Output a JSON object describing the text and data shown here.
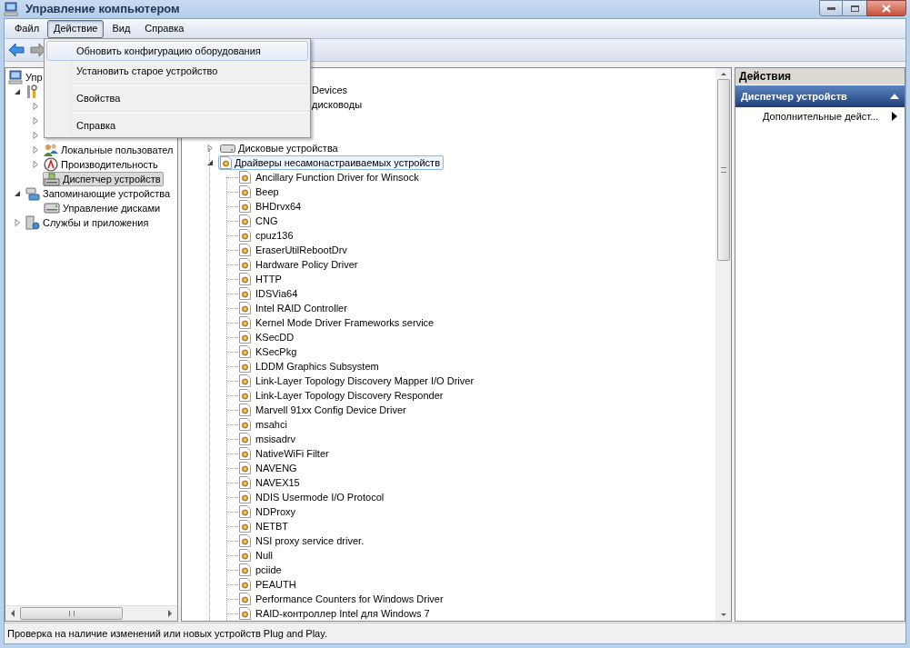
{
  "window": {
    "title": "Управление компьютером"
  },
  "menu_bar": [
    {
      "label": "Файл",
      "selected": false
    },
    {
      "label": "Действие",
      "selected": true
    },
    {
      "label": "Вид",
      "selected": false
    },
    {
      "label": "Справка",
      "selected": false
    }
  ],
  "open_menu": {
    "items": [
      {
        "kind": "item",
        "label": "Обновить конфигурацию оборудования",
        "selected": true
      },
      {
        "kind": "item",
        "label": "Установить старое устройство",
        "selected": false
      },
      {
        "kind": "separator"
      },
      {
        "kind": "item",
        "label": "Свойства",
        "selected": false
      },
      {
        "kind": "separator"
      },
      {
        "kind": "item",
        "label": "Справка",
        "selected": false
      }
    ]
  },
  "navigation_tree": [
    {
      "label": "Упр",
      "selected": false,
      "children": [
        {
          "expanded": true,
          "children": [
            {
              "expanded": false
            },
            {
              "expanded": false
            },
            {
              "expanded": false
            },
            {
              "label": "Локальные пользовател",
              "expanded": false,
              "selected": false
            },
            {
              "label": "Производительность",
              "expanded": false,
              "selected": false
            },
            {
              "label": "Диспетчер устройств",
              "selected": true
            }
          ]
        },
        {
          "label": "Запоминающие устройства",
          "expanded": true,
          "selected": false,
          "children": [
            {
              "label": "Управление дисками",
              "selected": false
            }
          ]
        },
        {
          "label": "Службы и приложения",
          "expanded": false,
          "selected": false
        }
      ]
    }
  ],
  "device_tree": [
    {
      "kind": "covered"
    },
    {
      "kind": "covered",
      "label": "Devices"
    },
    {
      "kind": "covered",
      "label": "дисководы"
    },
    {
      "kind": "covered"
    },
    {
      "kind": "covered"
    },
    {
      "kind": "node",
      "label": "Дисковые устройства",
      "expanded": false,
      "selected": false
    },
    {
      "kind": "node",
      "label": "Драйверы несамонастраиваемых устройств",
      "expanded": true,
      "selected": true,
      "children": [
        {
          "label": "Ancillary Function Driver for Winsock",
          "selected": false
        },
        {
          "label": "Beep",
          "selected": false
        },
        {
          "label": "BHDrvx64",
          "selected": false
        },
        {
          "label": "CNG",
          "selected": false
        },
        {
          "label": "cpuz136",
          "selected": false
        },
        {
          "label": "EraserUtilRebootDrv",
          "selected": false
        },
        {
          "label": "Hardware Policy Driver",
          "selected": false
        },
        {
          "label": "HTTP",
          "selected": false
        },
        {
          "label": "IDSVia64",
          "selected": false
        },
        {
          "label": "Intel RAID Controller",
          "selected": false
        },
        {
          "label": "Kernel Mode Driver Frameworks service",
          "selected": false
        },
        {
          "label": "KSecDD",
          "selected": false
        },
        {
          "label": "KSecPkg",
          "selected": false
        },
        {
          "label": "LDDM Graphics Subsystem",
          "selected": false
        },
        {
          "label": "Link-Layer Topology Discovery Mapper I/O Driver",
          "selected": false
        },
        {
          "label": "Link-Layer Topology Discovery Responder",
          "selected": false
        },
        {
          "label": "Marvell 91xx Config Device Driver",
          "selected": false
        },
        {
          "label": "msahci",
          "selected": false
        },
        {
          "label": "msisadrv",
          "selected": false
        },
        {
          "label": "NativeWiFi Filter",
          "selected": false
        },
        {
          "label": "NAVENG",
          "selected": false
        },
        {
          "label": "NAVEX15",
          "selected": false
        },
        {
          "label": "NDIS Usermode I/O Protocol",
          "selected": false
        },
        {
          "label": "NDProxy",
          "selected": false
        },
        {
          "label": "NETBT",
          "selected": false
        },
        {
          "label": "NSI proxy service driver.",
          "selected": false
        },
        {
          "label": "Null",
          "selected": false
        },
        {
          "label": "pciide",
          "selected": false
        },
        {
          "label": "PEAUTH",
          "selected": false
        },
        {
          "label": "Performance Counters for Windows Driver",
          "selected": false
        },
        {
          "label": "RAID-контроллер Intel для Windows 7",
          "selected": false
        }
      ]
    }
  ],
  "actions_pane": {
    "title": "Действия",
    "section": {
      "title": "Диспетчер устройств",
      "expanded": true
    },
    "items": [
      {
        "label": "Дополнительные дейст...",
        "has_submenu": true
      }
    ]
  },
  "status_bar": "Проверка на наличие изменений или новых устройств Plug and Play."
}
